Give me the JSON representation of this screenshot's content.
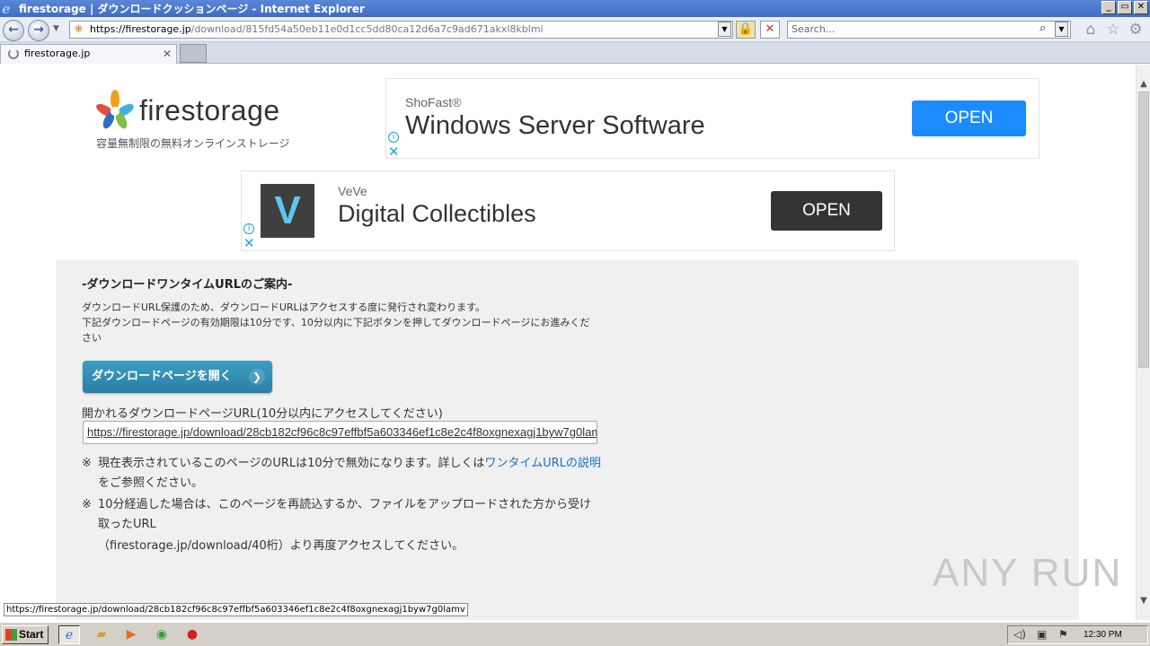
{
  "window": {
    "title": "firestorage | ダウンロードクッションページ - Internet Explorer",
    "buttons": [
      "_",
      "▭",
      "✕"
    ]
  },
  "navbar": {
    "address_host": "https://firestorage.jp",
    "address_path": "/download/815fd54a50eb11e0d1cc5dd80ca12d6a7c9ad671akxl8kblmi",
    "search_placeholder": "Search..."
  },
  "tab": {
    "label": "firestorage.jp"
  },
  "site": {
    "logo_text": "firestorage",
    "tagline": "容量無制限の無料オンラインストレージ"
  },
  "ads": [
    {
      "brand": "ShoFast®",
      "headline": "Windows Server Software",
      "cta": "OPEN",
      "cta_color": "#1a8cff"
    },
    {
      "brand": "VeVe",
      "headline": "Digital Collectibles",
      "cta": "OPEN",
      "cta_color": "#333333",
      "logo_letter": "V"
    }
  ],
  "panel": {
    "title": "-ダウンロードワンタイムURLのご案内-",
    "desc_line1": "ダウンロードURL保護のため、ダウンロードURLはアクセスする度に発行され変わります。",
    "desc_line2": "下記ダウンロードページの有効期限は10分です、10分以内に下記ボタンを押してダウンロードページにお進みください",
    "button_label": "ダウンロードページを開く",
    "url_label": "開かれるダウンロードページURL(10分以内にアクセスしてください)",
    "url_value": "https://firestorage.jp/download/28cb182cf96c8c97effbf5a603346ef1c8e2c4f8oxgnexagj1byw7g0lamv",
    "note_mark": "※",
    "note1_text": "現在表示されているこのページのURLは10分で無効になります。詳しくは",
    "note1_link": "ワンタイムURLの説明",
    "note1_suffix": "をご参照ください。",
    "note2_text": "10分経過した場合は、このページを再読込するか、ファイルをアップロードされた方から受け取ったURL",
    "note2_line2": "（firestorage.jp/download/40桁）より再度アクセスしてください。"
  },
  "status_url": "https://firestorage.jp/download/28cb182cf96c8c97effbf5a603346ef1c8e2c4f8oxgnexagj1byw7g0lamv",
  "watermark": "ANY RUN",
  "taskbar": {
    "start_label": "Start",
    "clock": "12:30 PM"
  }
}
